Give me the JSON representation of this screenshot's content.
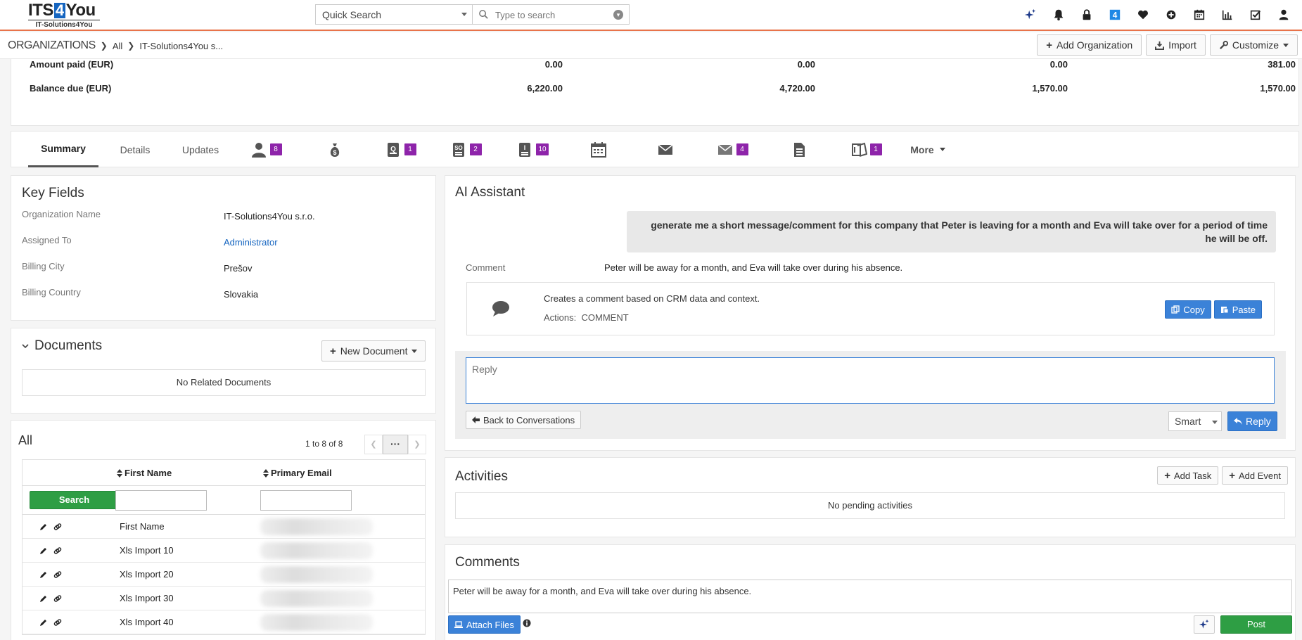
{
  "logo": {
    "main_pre": "ITS",
    "main_four": "4",
    "main_post": "You",
    "sub": "IT-Solutions4You"
  },
  "search": {
    "scope": "Quick Search",
    "placeholder": "Type to search"
  },
  "top_icons": [
    "ai-sparkle-icon",
    "bell-icon",
    "lock-icon",
    "four-icon",
    "heart-icon",
    "plus-circle-icon",
    "calendar-icon",
    "bar-chart-icon",
    "checkbox-icon",
    "user-icon"
  ],
  "breadcrumb": {
    "module": "ORGANIZATIONS",
    "all": "All",
    "record": "IT-Solutions4You s..."
  },
  "header_buttons": {
    "add": "Add Organization",
    "import": "Import",
    "customize": "Customize"
  },
  "totals": {
    "rows": [
      {
        "label": "Amount paid (EUR)",
        "values": [
          "0.00",
          "0.00",
          "0.00",
          "381.00"
        ]
      },
      {
        "label": "Balance due (EUR)",
        "values": [
          "6,220.00",
          "4,720.00",
          "1,570.00",
          "1,570.00"
        ]
      }
    ]
  },
  "tabs": {
    "summary": "Summary",
    "details": "Details",
    "updates": "Updates",
    "contacts_count": "8",
    "quotes_count": "1",
    "sales_orders_count": "2",
    "invoices_count": "10",
    "emails_count": "4",
    "tickets_count": "1",
    "more": "More"
  },
  "key_fields": {
    "title": "Key Fields",
    "rows": [
      {
        "label": "Organization Name",
        "value": "IT-Solutions4You s.r.o."
      },
      {
        "label": "Assigned To",
        "value": "Administrator"
      },
      {
        "label": "Billing City",
        "value": "Prešov"
      },
      {
        "label": "Billing Country",
        "value": "Slovakia"
      }
    ]
  },
  "documents": {
    "title": "Documents",
    "new_button": "New Document",
    "empty": "No Related Documents"
  },
  "contacts_list": {
    "title": "All",
    "pagination": "1 to 8  of 8",
    "columns": {
      "first_name": "First Name",
      "primary_email": "Primary Email"
    },
    "search_button": "Search",
    "rows": [
      "First Name",
      "Xls Import 10",
      "Xls Import 20",
      "Xls Import 30",
      "Xls Import 40"
    ]
  },
  "ai": {
    "title": "AI Assistant",
    "user_message": "generate me a short message/comment for this company that Peter is leaving for a month and Eva will take over for a period of time he will be off.",
    "result_label": "Comment",
    "result_text": "Peter will be away for a month, and Eva will take over during his absence.",
    "tool_description": "Creates a comment based on CRM data and context.",
    "actions_label": "Actions:",
    "actions_value": "COMMENT",
    "copy": "Copy",
    "paste": "Paste",
    "reply_placeholder": "Reply",
    "back": "Back to Conversations",
    "mode": "Smart",
    "reply": "Reply"
  },
  "activities": {
    "title": "Activities",
    "add_task": "Add Task",
    "add_event": "Add Event",
    "empty": "No pending activities"
  },
  "comments": {
    "title": "Comments",
    "text": "Peter will be away for a month, and Eva will take over during his absence.",
    "attach": "Attach Files",
    "post": "Post"
  },
  "colors": {
    "accent_orange": "#e8734a",
    "badge_purple": "#8e24aa",
    "primary_blue": "#3b82d8",
    "success_green": "#2e9e44"
  }
}
